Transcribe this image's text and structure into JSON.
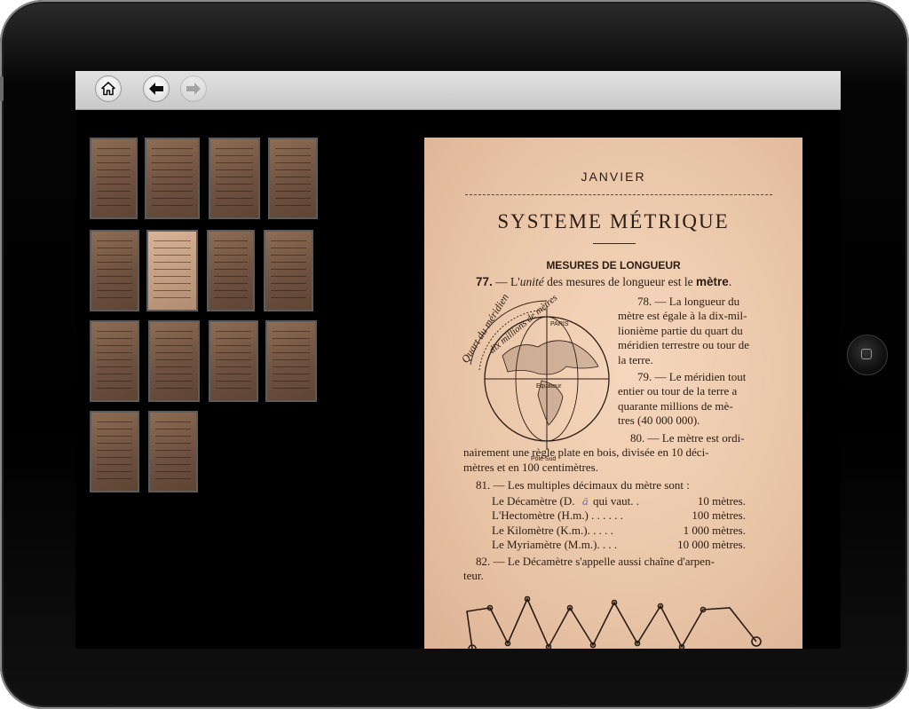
{
  "toolbar": {
    "buttons": [
      {
        "name": "home",
        "icon": "home-icon",
        "enabled": true
      },
      {
        "name": "back",
        "icon": "arrow-left-icon",
        "enabled": true
      },
      {
        "name": "forward",
        "icon": "arrow-right-icon",
        "enabled": false
      }
    ]
  },
  "thumbnails": [
    {
      "index": 1,
      "selected": false
    },
    {
      "index": 2,
      "selected": false
    },
    {
      "index": 3,
      "selected": false
    },
    {
      "index": 4,
      "selected": false
    },
    {
      "index": 5,
      "selected": false
    },
    {
      "index": 6,
      "selected": true
    },
    {
      "index": 7,
      "selected": false
    },
    {
      "index": 8,
      "selected": false
    },
    {
      "index": 9,
      "selected": false
    },
    {
      "index": 10,
      "selected": false
    },
    {
      "index": 11,
      "selected": false
    },
    {
      "index": 12,
      "selected": false
    },
    {
      "index": 13,
      "selected": false
    },
    {
      "index": 14,
      "selected": false
    }
  ],
  "page": {
    "header": "JANVIER",
    "title": "SYSTEME MÉTRIQUE",
    "subtitle": "MESURES DE LONGUEUR",
    "globe": {
      "arc_label": "Quart du méridien",
      "arc_label2": "dix millions de mètres",
      "paris": "PARIS",
      "equator": "Equateur",
      "south_pole": "Pôle Sud"
    },
    "p77": {
      "num": "77.",
      "dash": "—",
      "text1": "L'",
      "unit": "unité",
      "text2": " des mesures de longueur est le ",
      "metre": "mètre",
      "end": "."
    },
    "p78_lines": [
      "78. — La longueur du",
      "mètre est égale à la dix-mil-",
      "lionième partie du quart du",
      "méridien terrestre ou tour de",
      "la terre."
    ],
    "p79_lines": [
      "79. — Le méridien tout",
      "entier ou tour de la terre a",
      "quarante millions de mè-",
      "tres (40 000 000)."
    ],
    "p80_lines": [
      "80. — Le mètre est ordi-",
      "nairement une règle plate en bois, divisée en 10 déci-",
      "mètres et en 100 centimètres."
    ],
    "p81_intro": "81. — Les multiples décimaux du mètre sont :",
    "multiples": [
      {
        "label": "Le Décamètre (D.",
        "abbrev_tail": "ā",
        "middle": " qui vaut. . ",
        "value": "10 mètres."
      },
      {
        "label": "L'Hectomètre (H.m.) . . . . . .",
        "abbrev_tail": "",
        "middle": "",
        "value": "100 mètres."
      },
      {
        "label": "Le Kilomètre (K.m.). . . . .",
        "abbrev_tail": "",
        "middle": "",
        "value": "1 000 mètres."
      },
      {
        "label": "Le Myriamètre (M.m.). . . .",
        "abbrev_tail": "",
        "middle": "",
        "value": "10 000 mètres."
      }
    ],
    "p82_lines": [
      "82. — Le Décamètre s'appelle aussi chaîne d'arpen-",
      "teur."
    ]
  },
  "colors": {
    "paper": "#eac6a8",
    "ink": "#2a1d14",
    "toolbar": "#d3d3d3",
    "frame": "#050505"
  }
}
